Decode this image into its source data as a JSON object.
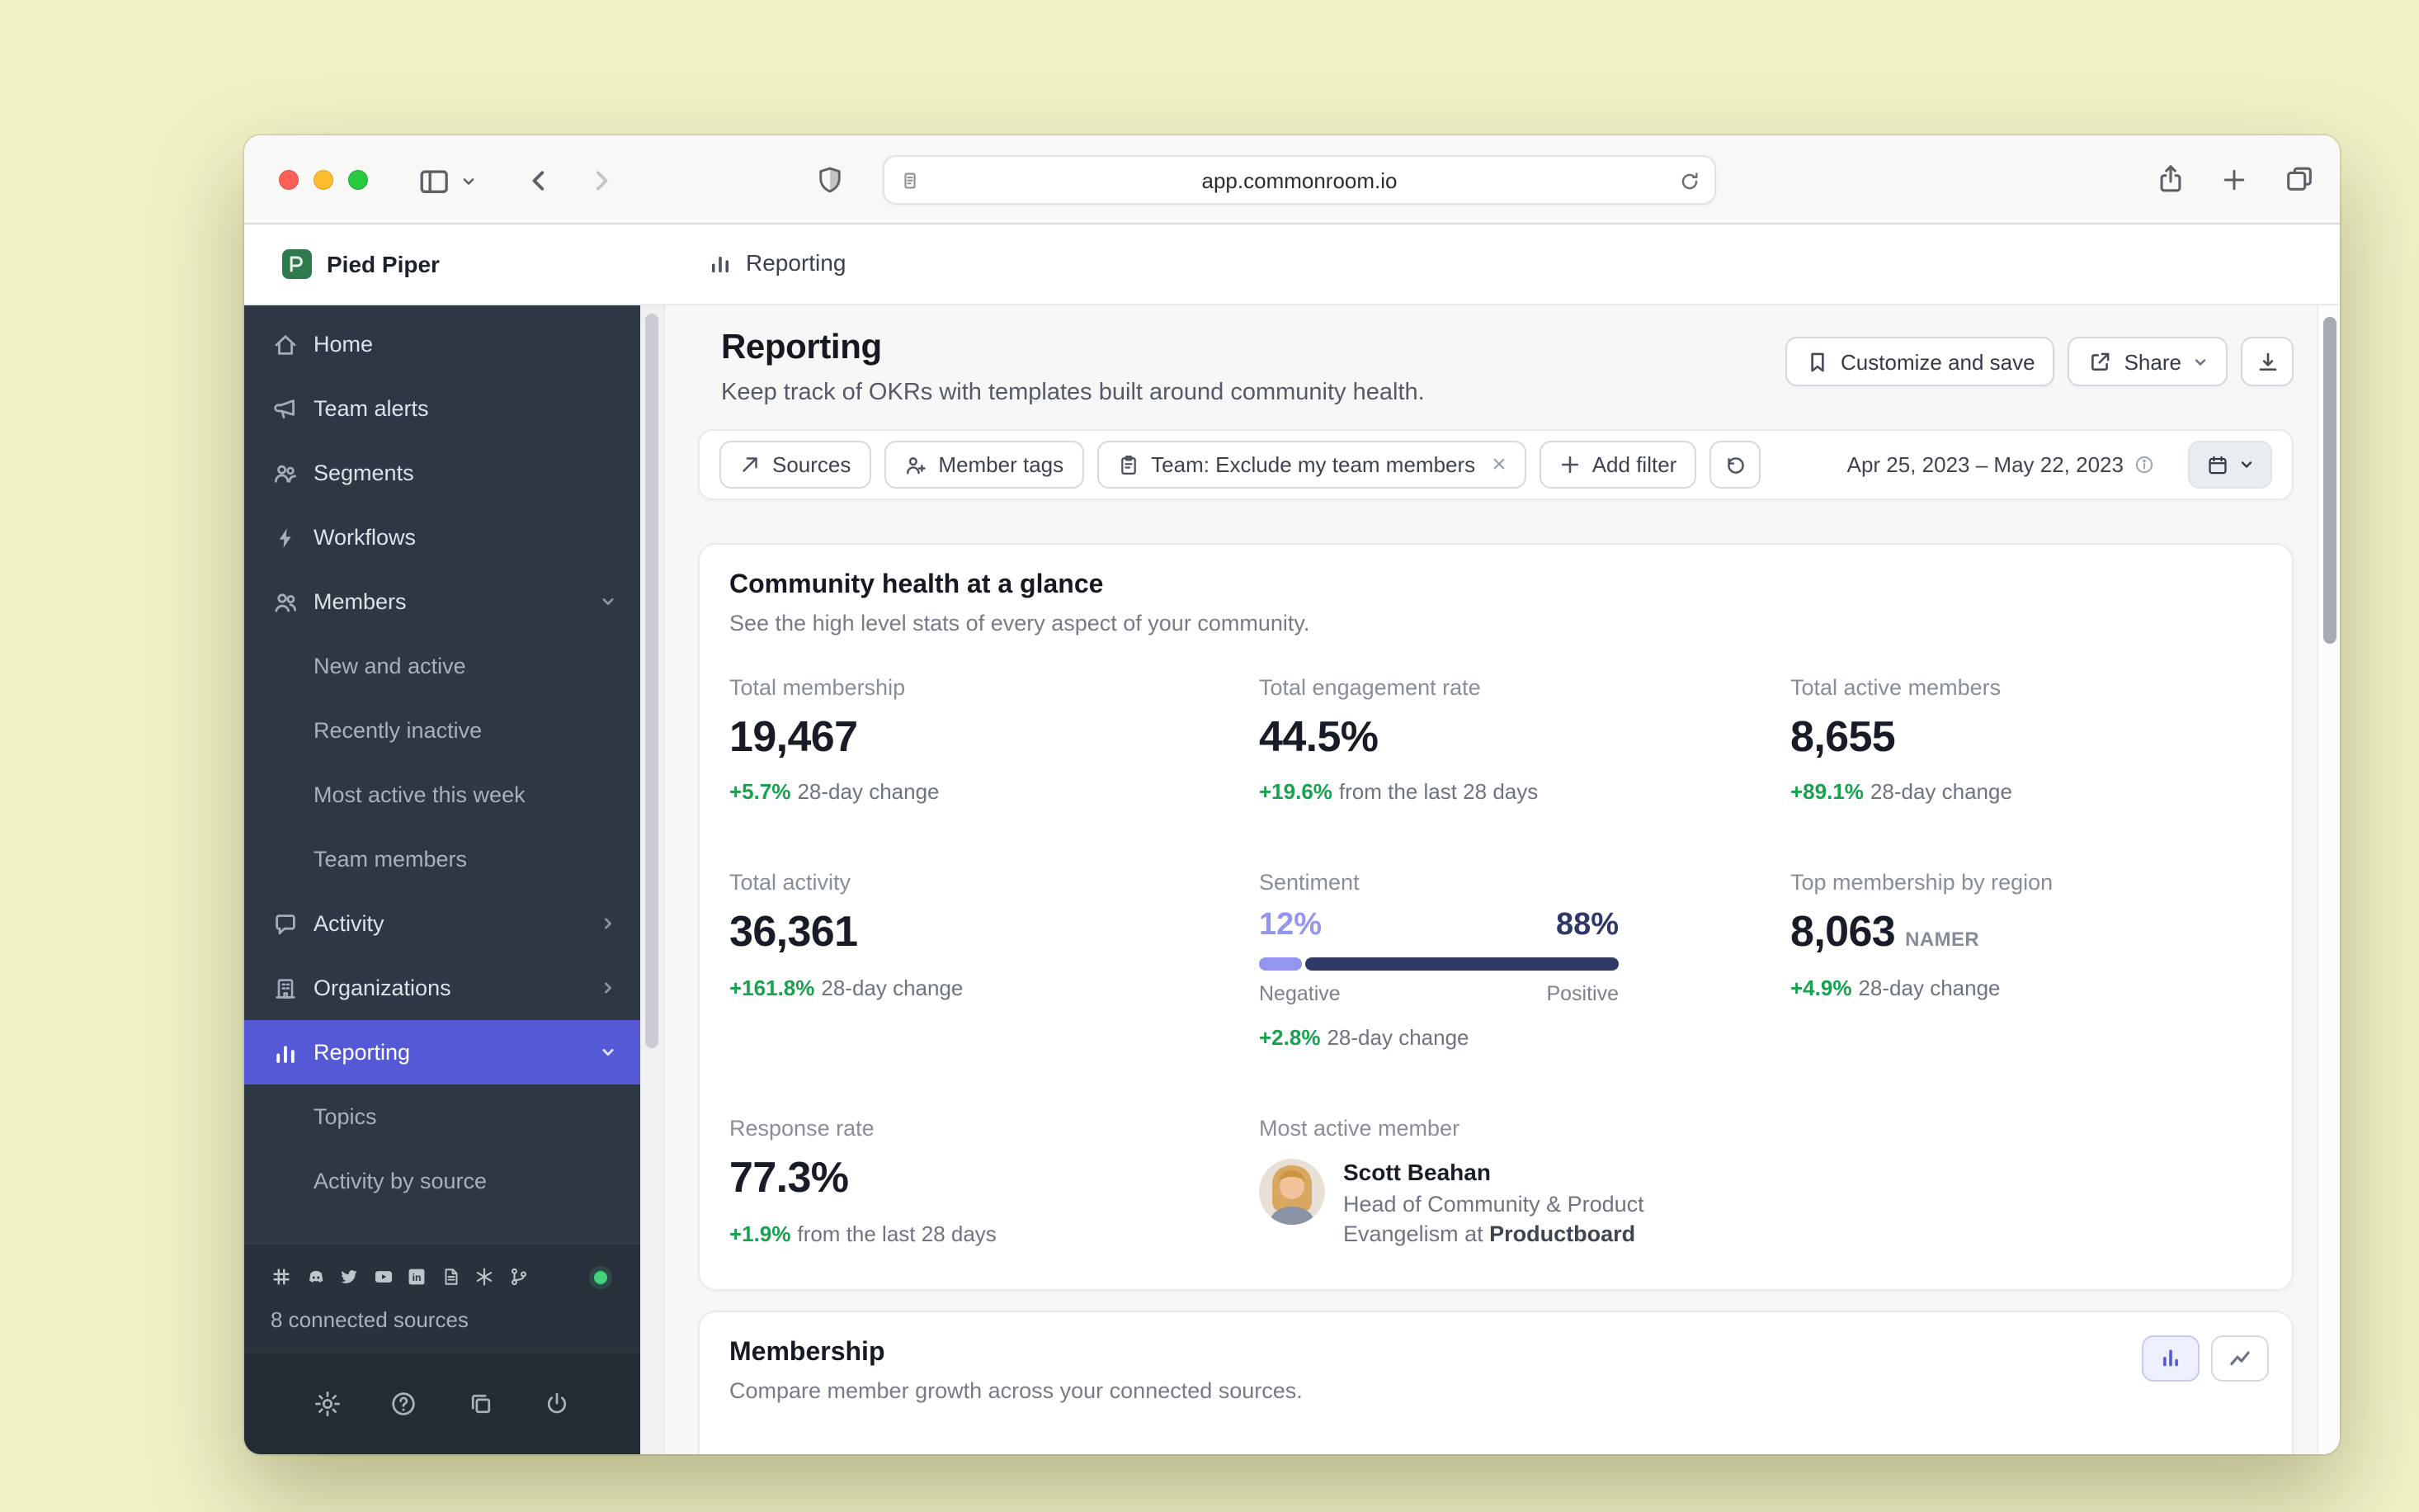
{
  "browser": {
    "url": "app.commonroom.io"
  },
  "workspace": {
    "name": "Pied Piper",
    "breadcrumb": "Reporting"
  },
  "sidebar": {
    "items": [
      {
        "label": "Home",
        "icon": "home"
      },
      {
        "label": "Team alerts",
        "icon": "megaphone"
      },
      {
        "label": "Segments",
        "icon": "people-group"
      },
      {
        "label": "Workflows",
        "icon": "lightning"
      },
      {
        "label": "Members",
        "icon": "members",
        "expanded": true
      },
      {
        "label": "New and active",
        "child": true
      },
      {
        "label": "Recently inactive",
        "child": true
      },
      {
        "label": "Most active this week",
        "child": true
      },
      {
        "label": "Team members",
        "child": true
      },
      {
        "label": "Activity",
        "icon": "chat",
        "collapsed": true
      },
      {
        "label": "Organizations",
        "icon": "building",
        "collapsed": true
      },
      {
        "label": "Reporting",
        "icon": "bar-chart",
        "selected": true,
        "expanded": true
      },
      {
        "label": "Topics",
        "child": true
      },
      {
        "label": "Activity by source",
        "child": true
      }
    ],
    "sources": [
      "slack",
      "discord",
      "twitter",
      "youtube",
      "linkedin",
      "docs",
      "snowflake",
      "git"
    ],
    "sources_summary": "8 connected sources"
  },
  "page": {
    "title": "Reporting",
    "subtitle": "Keep track of OKRs with templates built around community health.",
    "actions": {
      "customize": "Customize and save",
      "share": "Share"
    }
  },
  "filters": {
    "sources_label": "Sources",
    "member_tags_label": "Member tags",
    "team_filter_label": "Team: Exclude my team members",
    "add_filter_label": "Add filter",
    "date_range": "Apr 25, 2023 – May 22, 2023"
  },
  "glance": {
    "title": "Community health at a glance",
    "subtitle": "See the high level stats of every aspect of your community.",
    "stats": [
      {
        "label": "Total membership",
        "value": "19,467",
        "delta": "+5.7%",
        "note": "28-day change"
      },
      {
        "label": "Total engagement rate",
        "value": "44.5%",
        "delta": "+19.6%",
        "note": "from the last 28 days"
      },
      {
        "label": "Total active members",
        "value": "8,655",
        "delta": "+89.1%",
        "note": "28-day change"
      },
      {
        "label": "Total activity",
        "value": "36,361",
        "delta": "+161.8%",
        "note": "28-day change"
      },
      {
        "label": "Top membership by region",
        "value": "8,063",
        "region": "NAMER",
        "delta": "+4.9%",
        "note": "28-day change"
      },
      {
        "label": "Response rate",
        "value": "77.3%",
        "delta": "+1.9%",
        "note": "from the last 28 days"
      }
    ],
    "sentiment": {
      "label": "Sentiment",
      "negative_value": 12,
      "positive_value": 88,
      "negative_pct": "12%",
      "positive_pct": "88%",
      "negative_label": "Negative",
      "positive_label": "Positive",
      "delta": "+2.8%",
      "note": "28-day change"
    },
    "member": {
      "label": "Most active member",
      "name": "Scott Beahan",
      "role_line1": "Head of Community & Product",
      "role_line2": "Evangelism at",
      "company": "Productboard"
    }
  },
  "membership": {
    "title": "Membership",
    "subtitle": "Compare member growth across your connected sources."
  },
  "colors": {
    "accent": "#5659d6",
    "positive": "#18a24e",
    "sentiment-negative": "#9296ef",
    "sentiment-positive": "#2f3867",
    "status-green": "#43d17c"
  }
}
